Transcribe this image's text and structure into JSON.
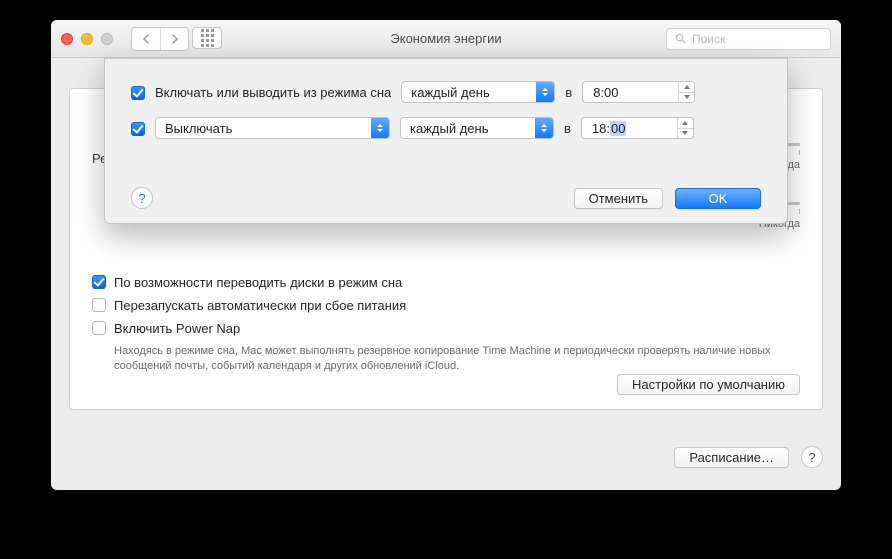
{
  "window": {
    "title": "Экономия энергии",
    "search_placeholder": "Поиск"
  },
  "sheet": {
    "row1": {
      "checked": true,
      "label": "Включать или выводить из режима сна",
      "frequency": "каждый день",
      "at": "в",
      "time": "8:00"
    },
    "row2": {
      "checked": true,
      "action": "Выключать",
      "frequency": "каждый день",
      "at": "в",
      "time_prefix": "18:",
      "time_sel": "00"
    },
    "cancel": "Отменить",
    "ok": "OK"
  },
  "panel": {
    "truncated_label": "Ре",
    "slider_never": "Никогда",
    "checks": [
      {
        "checked": true,
        "label": "По возможности переводить диски в режим сна"
      },
      {
        "checked": false,
        "label": "Перезапускать автоматически при сбое питания"
      },
      {
        "checked": false,
        "label": "Включить Power Nap"
      }
    ],
    "help_text": "Находясь в режиме сна, Mac может выполнять резервное копирование Time Machine и периодически проверять наличие новых сообщений почты, событий календаря и других обновлений iCloud.",
    "defaults_btn": "Настройки по умолчанию"
  },
  "footer": {
    "schedule_btn": "Расписание…"
  }
}
